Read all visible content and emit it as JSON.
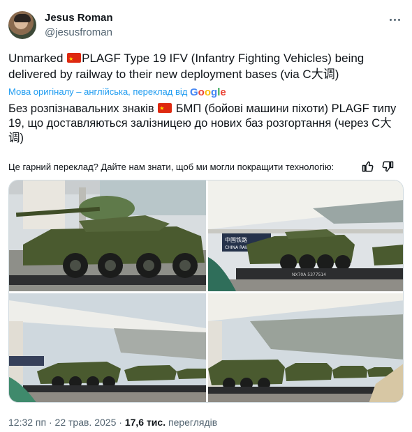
{
  "author": {
    "name": "Jesus Roman",
    "handle": "@jesusfroman"
  },
  "tweet": {
    "text_before_flag": "Unmarked ",
    "text_after_flag": "PLAGF Type 19 IFV (Infantry Fighting Vehicles) being delivered by railway to their new deployment bases (via C大调)"
  },
  "translation": {
    "attribution": "Мова оригіналу – англійська, переклад від",
    "provider": "Google",
    "text_before_flag": "Без розпізнавальних знаків ",
    "text_after_flag": " БМП (бойові машини піхоти) PLAGF типу 19, що доставляються залізницею до нових баз розгортання (через C大调)",
    "feedback_prompt": "Це гарний переклад? Дайте нам знати, щоб ми могли покращити технологію:"
  },
  "photos": [
    {
      "sign_text": "",
      "wagon_code": ""
    },
    {
      "sign_text": "CHINA RAILWAY",
      "sign_text_cn": "中国铁路",
      "wagon_code": "NX70A 5377514"
    },
    {
      "sign_text": "",
      "wagon_code": ""
    },
    {
      "sign_text": "",
      "wagon_code": ""
    }
  ],
  "meta": {
    "time": "12:32 пп",
    "separator": " · ",
    "date": "22 трав. 2025",
    "views_count": "17,6 тис.",
    "views_label": " переглядів"
  },
  "colors": {
    "link_blue": "#1d9bf0",
    "secondary_text": "#536471",
    "vehicle_green": "#4a5a2f",
    "flag_red": "#de2910"
  }
}
